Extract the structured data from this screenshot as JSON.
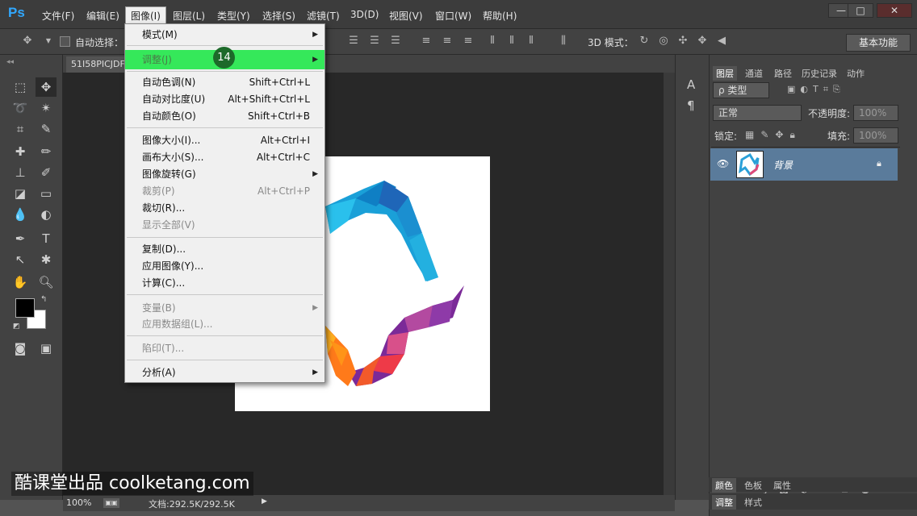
{
  "app": {
    "logo": "Ps"
  },
  "menubar": {
    "items": [
      "文件(F)",
      "编辑(E)",
      "图像(I)",
      "图层(L)",
      "类型(Y)",
      "选择(S)",
      "滤镜(T)",
      "3D(D)",
      "视图(V)",
      "窗口(W)",
      "帮助(H)"
    ],
    "active": "图像(I)",
    "window_buttons": [
      "—",
      "□",
      "✕"
    ]
  },
  "options_bar": {
    "auto_select_label": "自动选择：",
    "mode_3d_label": "3D 模式：",
    "workspace_button": "基本功能"
  },
  "document": {
    "tab_title": "51I58PICJDF",
    "zoom": "100%",
    "doc_info": "文档:292.5K/292.5K"
  },
  "image_menu": {
    "items": [
      {
        "label": "模式(M)",
        "shortcut": "",
        "submenu": true,
        "disabled": false
      },
      {
        "label": "调整(J)",
        "shortcut": "",
        "submenu": true,
        "disabled": false,
        "highlighted": true
      },
      {
        "label": "自动色调(N)",
        "shortcut": "Shift+Ctrl+L",
        "submenu": false,
        "disabled": false
      },
      {
        "label": "自动对比度(U)",
        "shortcut": "Alt+Shift+Ctrl+L",
        "submenu": false,
        "disabled": false
      },
      {
        "label": "自动颜色(O)",
        "shortcut": "Shift+Ctrl+B",
        "submenu": false,
        "disabled": false
      },
      {
        "label": "图像大小(I)...",
        "shortcut": "Alt+Ctrl+I",
        "submenu": false,
        "disabled": false
      },
      {
        "label": "画布大小(S)...",
        "shortcut": "Alt+Ctrl+C",
        "submenu": false,
        "disabled": false
      },
      {
        "label": "图像旋转(G)",
        "shortcut": "",
        "submenu": true,
        "disabled": false
      },
      {
        "label": "裁剪(P)",
        "shortcut": "Alt+Ctrl+P",
        "submenu": false,
        "disabled": true
      },
      {
        "label": "裁切(R)...",
        "shortcut": "",
        "submenu": false,
        "disabled": false
      },
      {
        "label": "显示全部(V)",
        "shortcut": "",
        "submenu": false,
        "disabled": true
      },
      {
        "label": "复制(D)...",
        "shortcut": "",
        "submenu": false,
        "disabled": false
      },
      {
        "label": "应用图像(Y)...",
        "shortcut": "",
        "submenu": false,
        "disabled": false
      },
      {
        "label": "计算(C)...",
        "shortcut": "",
        "submenu": false,
        "disabled": false
      },
      {
        "label": "变量(B)",
        "shortcut": "",
        "submenu": true,
        "disabled": true
      },
      {
        "label": "应用数据组(L)...",
        "shortcut": "",
        "submenu": false,
        "disabled": true
      },
      {
        "label": "陷印(T)...",
        "shortcut": "",
        "submenu": false,
        "disabled": true
      },
      {
        "label": "分析(A)",
        "shortcut": "",
        "submenu": true,
        "disabled": false
      }
    ],
    "step_badge": "14"
  },
  "layers_panel": {
    "tabs": [
      "图层",
      "通道",
      "路径",
      "历史记录",
      "动作"
    ],
    "filter_label": "ρ 类型",
    "blend_mode": "正常",
    "opacity_label": "不透明度:",
    "opacity_value": "100%",
    "lock_label": "锁定:",
    "fill_label": "填充:",
    "fill_value": "100%",
    "layer_name": "背景"
  },
  "color_panel": {
    "tabs": [
      "颜色",
      "色板",
      "属性"
    ]
  },
  "adjust_panel": {
    "tabs": [
      "调整",
      "样式"
    ]
  },
  "watermark": "酷课堂出品 coolketang.com",
  "colors": {
    "highlight": "#35e85a",
    "badge": "#1d6a2a",
    "layer_selected": "#5a7b9b"
  }
}
